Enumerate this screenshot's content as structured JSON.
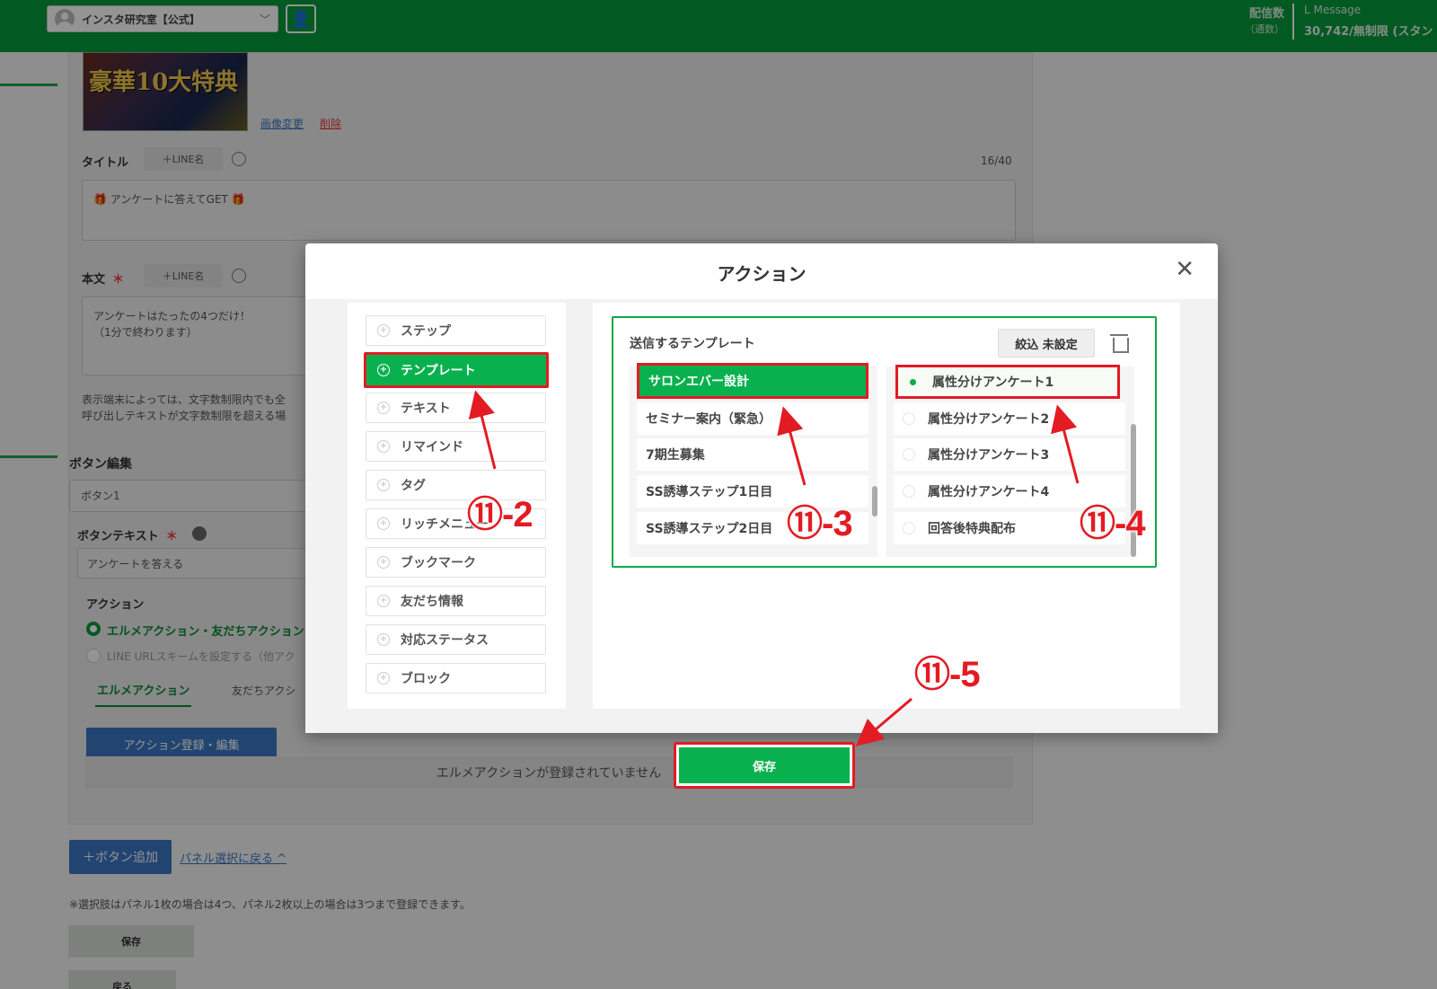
{
  "header": {
    "account_name": "インスタ研究室【公式】",
    "chevron": "chevron-down-icon",
    "stat_label": "配信数",
    "stat_sub": "（通数）",
    "app_name": "L Message",
    "stat_count": "30,742/無制限 (スタン"
  },
  "background": {
    "banner_text": "豪華10大特典",
    "image_change": "画像変更",
    "image_delete": "削除",
    "title_label": "タイトル",
    "title_chip": "＋LINE名",
    "title_counter": "16/40",
    "title_value": "🎁 アンケートに答えてGET 🎁",
    "body_label": "本文",
    "required_mark": "＊",
    "body_chip": "＋LINE名",
    "body_value_1": "アンケートはたったの4つだけ！",
    "body_value_2": "（1分で終わります）",
    "note_1": "表示端末によっては、文字数制限内でも全",
    "note_2": "呼び出しテキストが文字数制限を超える場",
    "button_edit_heading": "ボタン編集",
    "button_1_tab": "ボタン1",
    "button_text_label": "ボタンテキスト",
    "button_text_value": "アンケートを答える",
    "action_label": "アクション",
    "radio_1": "エルメアクション・友だちアクション",
    "radio_2": "LINE URLスキームを設定する（他アク",
    "tab_1": "エルメアクション",
    "tab_2": "友だちアクシ",
    "register_button": "アクション登録・編集",
    "no_action_text": "エルメアクションが登録されていません",
    "add_button": "＋ボタン追加",
    "back_to_panel": "パネル選択に戻る ^",
    "limit_note": "※選択肢はパネル1枚の場合は4つ、パネル2枚以上の場合は3つまで登録できます。",
    "save_small": "保存",
    "back_small": "戻る"
  },
  "modal": {
    "title": "アクション",
    "close_icon": "close-icon",
    "menu": [
      {
        "label": "ステップ",
        "active": false
      },
      {
        "label": "テンプレート",
        "active": true
      },
      {
        "label": "テキスト",
        "active": false
      },
      {
        "label": "リマインド",
        "active": false
      },
      {
        "label": "タグ",
        "active": false
      },
      {
        "label": "リッチメニュー",
        "active": false
      },
      {
        "label": "ブックマーク",
        "active": false
      },
      {
        "label": "友だち情報",
        "active": false
      },
      {
        "label": "対応ステータス",
        "active": false
      },
      {
        "label": "ブロック",
        "active": false
      }
    ],
    "template_label": "送信するテンプレート",
    "filter_button": "絞込 未設定",
    "trash_icon": "trash-icon",
    "folders": [
      {
        "label": "サロンエバー設計",
        "active": true
      },
      {
        "label": "セミナー案内（緊急）",
        "active": false
      },
      {
        "label": "7期生募集",
        "active": false
      },
      {
        "label": "SS誘導ステップ1日目",
        "active": false
      },
      {
        "label": "SS誘導ステップ2日目",
        "active": false
      }
    ],
    "templates": [
      {
        "label": "属性分けアンケート1",
        "checked": true
      },
      {
        "label": "属性分けアンケート2",
        "checked": false
      },
      {
        "label": "属性分けアンケート3",
        "checked": false
      },
      {
        "label": "属性分けアンケート4",
        "checked": false
      },
      {
        "label": "回答後特典配布",
        "checked": false
      }
    ],
    "save_button": "保存"
  },
  "annotations": {
    "step_2": "⑪-2",
    "step_3": "⑪-3",
    "step_4": "⑪-4",
    "step_5": "⑪-5",
    "color": "#e31b23"
  }
}
